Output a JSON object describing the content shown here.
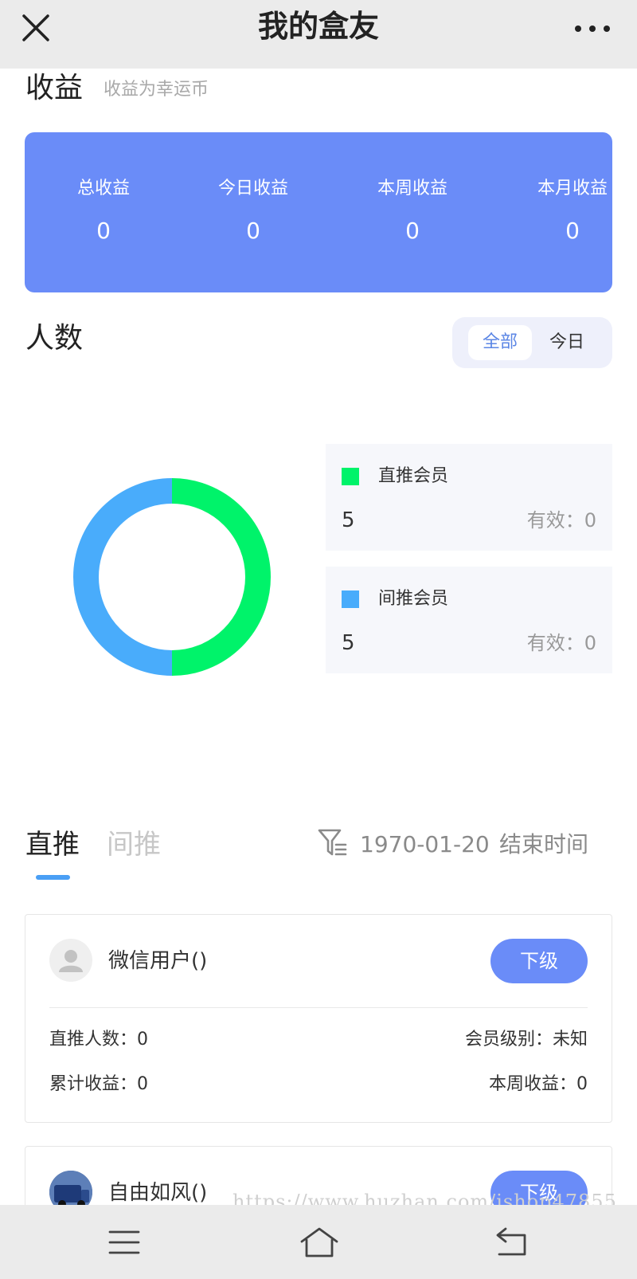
{
  "header": {
    "title": "我的盒友",
    "close_icon": "close-icon",
    "more_icon": "more-icon"
  },
  "earnings": {
    "title": "收益",
    "subtitle": "收益为幸运币",
    "items": [
      {
        "label": "总收益",
        "value": "0"
      },
      {
        "label": "今日收益",
        "value": "0"
      },
      {
        "label": "本周收益",
        "value": "0"
      },
      {
        "label": "本月收益",
        "value": "0"
      }
    ],
    "card_color": "#6a8cf8"
  },
  "count": {
    "title": "人数",
    "segment": [
      {
        "label": "全部",
        "active": true
      },
      {
        "label": "今日",
        "active": false
      }
    ],
    "chart_data": {
      "type": "pie",
      "series": [
        {
          "name": "直推会员",
          "value": 5,
          "color": "#00f36a"
        },
        {
          "name": "间推会员",
          "value": 5,
          "color": "#49acfb"
        }
      ]
    },
    "legend": [
      {
        "name": "直推会员",
        "count": "5",
        "valid": "有效：0",
        "color": "#00f36a"
      },
      {
        "name": "间推会员",
        "count": "5",
        "valid": "有效：0",
        "color": "#49acfb"
      }
    ]
  },
  "tabs": [
    {
      "label": "直推",
      "active": true
    },
    {
      "label": "间推",
      "active": false
    }
  ],
  "filter": {
    "icon": "filter-icon",
    "date": "1970-01-20",
    "end_label": "结束时间"
  },
  "members": [
    {
      "name": "微信用户()",
      "button": "下级",
      "stats": {
        "direct": "直推人数：0",
        "level": "会员级别：未知",
        "total": "累计收益：0",
        "week": "本周收益：0"
      }
    },
    {
      "name": "自由如风()",
      "button": "下级"
    }
  ],
  "watermark": "https://www.huzhan.com/ishop47855",
  "bottom_nav": {
    "menu_icon": "menu-icon",
    "home_icon": "home-icon",
    "back_icon": "back-icon"
  }
}
